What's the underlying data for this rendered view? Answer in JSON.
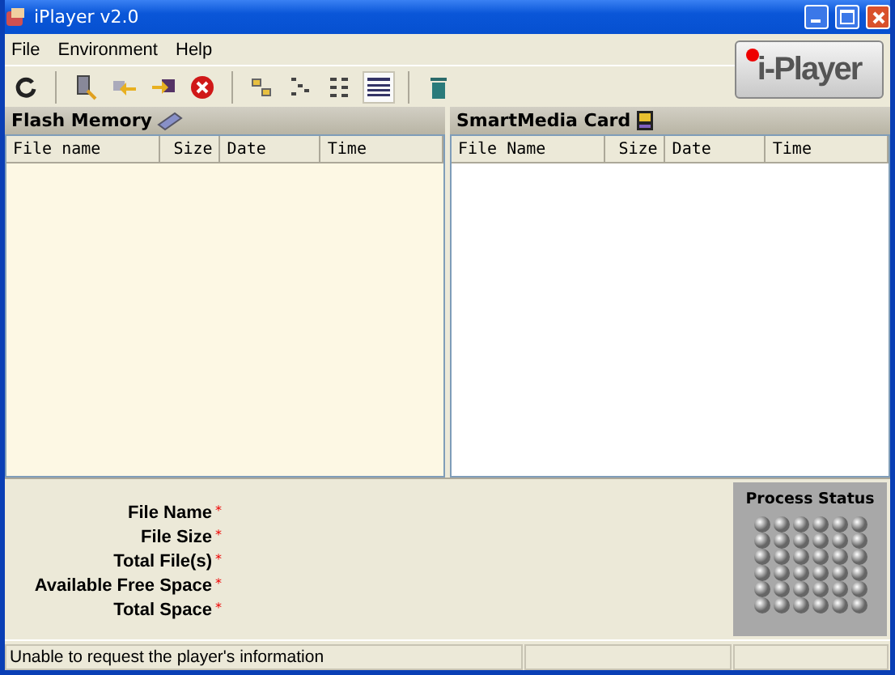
{
  "window": {
    "title": "iPlayer v2.0"
  },
  "menu": [
    "File",
    "Environment",
    "Help"
  ],
  "toolbar": {
    "views": [
      {
        "selected": false
      },
      {
        "selected": false
      },
      {
        "selected": false
      },
      {
        "selected": true
      }
    ]
  },
  "logo": {
    "text": "i-Player"
  },
  "panels": [
    {
      "title": "Flash Memory",
      "kind": "flash",
      "columns": [
        "File name",
        "Size",
        "Date",
        "Time"
      ]
    },
    {
      "title": "SmartMedia Card",
      "kind": "card",
      "columns": [
        "File Name",
        "Size",
        "Date",
        "Time"
      ]
    }
  ],
  "info": [
    {
      "label": "File Name",
      "value": "*"
    },
    {
      "label": "File Size",
      "value": "*"
    },
    {
      "label": "Total File(s)",
      "value": "*"
    },
    {
      "label": "Available Free Space",
      "value": "*"
    },
    {
      "label": "Total Space",
      "value": "*"
    }
  ],
  "process_status": {
    "title": "Process Status"
  },
  "status_bar": {
    "message": "Unable to request the player's information"
  }
}
